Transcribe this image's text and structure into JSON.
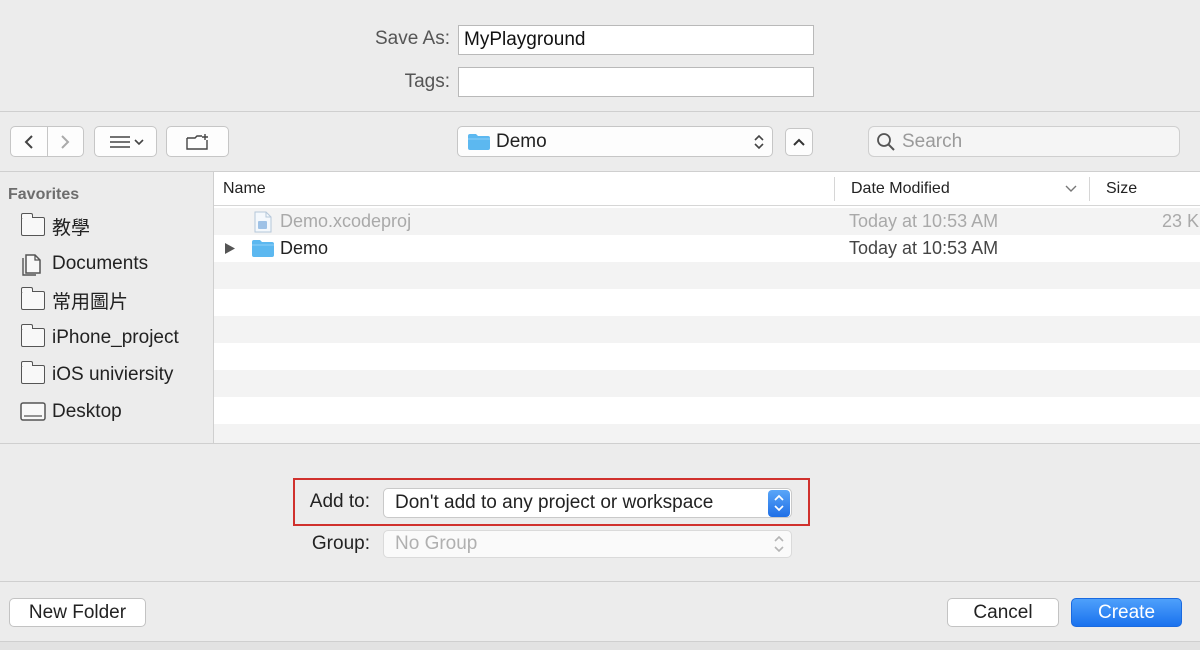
{
  "save": {
    "save_as_label": "Save As:",
    "save_as_value": "MyPlayground",
    "tags_label": "Tags:",
    "tags_value": ""
  },
  "toolbar": {
    "location": "Demo",
    "search_placeholder": "Search"
  },
  "sidebar": {
    "header": "Favorites",
    "items": [
      {
        "label": "教學",
        "icon": "folder-icon"
      },
      {
        "label": "Documents",
        "icon": "documents-icon"
      },
      {
        "label": "常用圖片",
        "icon": "folder-icon"
      },
      {
        "label": "iPhone_project",
        "icon": "folder-icon"
      },
      {
        "label": "iOS univiersity",
        "icon": "folder-icon"
      },
      {
        "label": "Desktop",
        "icon": "desktop-icon"
      }
    ]
  },
  "filelist": {
    "columns": {
      "name": "Name",
      "date": "Date Modified",
      "size": "Size"
    },
    "rows": [
      {
        "name": "Demo.xcodeproj",
        "date": "Today at 10:53 AM",
        "size": "23 K",
        "disabled": true
      },
      {
        "name": "Demo",
        "date": "Today at 10:53 AM",
        "size": "",
        "disabled": false
      }
    ]
  },
  "options": {
    "add_to_label": "Add to:",
    "add_to_value": "Don't add to any project or workspace",
    "group_label": "Group:",
    "group_value": "No Group",
    "highlight_color": "#d0312d"
  },
  "buttons": {
    "new_folder": "New Folder",
    "cancel": "Cancel",
    "create": "Create"
  },
  "colors": {
    "accent": "#1a72ee",
    "folder_blue": "#5cb8f0"
  }
}
